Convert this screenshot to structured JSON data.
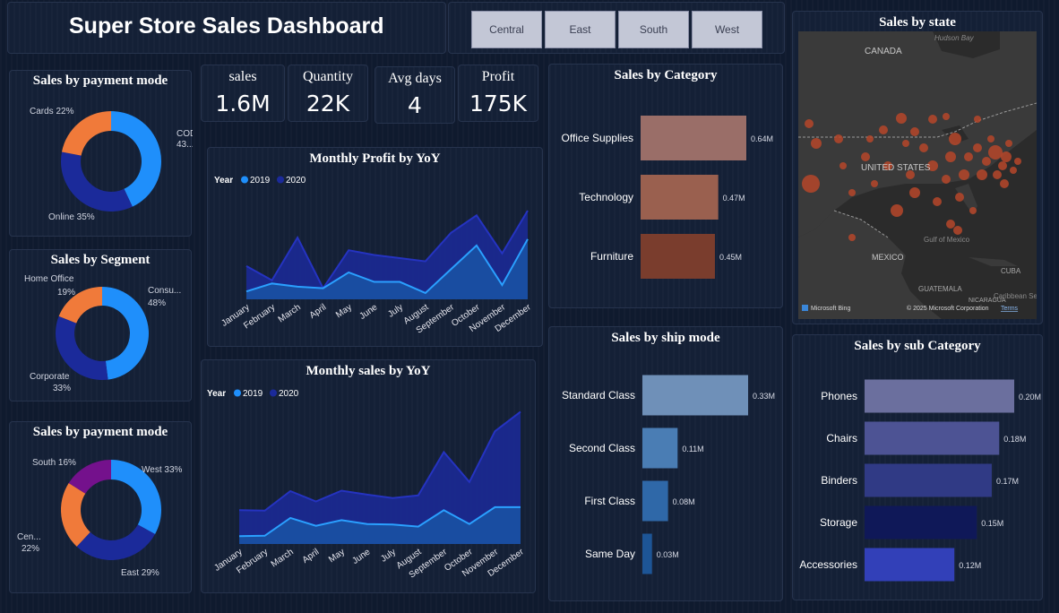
{
  "title": "Super Store Sales Dashboard",
  "slicer": [
    "Central",
    "East",
    "South",
    "West"
  ],
  "kpis": [
    {
      "label": "sales",
      "value": "1.6M"
    },
    {
      "label": "Quantity",
      "value": "22K"
    },
    {
      "label": "Avg days",
      "value": "4"
    },
    {
      "label": "Profit",
      "value": "175K"
    }
  ],
  "colors": {
    "background": "#0f1a2e",
    "panel": "#142036",
    "series2019": "#1f8ffb",
    "series2020": "#1b2a9a",
    "donut_blue": "#1f8ffb",
    "donut_orange": "#f07a3a",
    "donut_navy": "#1b2a9a",
    "donut_purple": "#74118c"
  },
  "map": {
    "title": "Sales by state",
    "labels": [
      "Hudson Bay",
      "CANADA",
      "UNITED STATES",
      "Gulf of Mexico",
      "MEXICO",
      "CUBA",
      "GUATEMALA",
      "Caribbean Se",
      "NICARAGUA"
    ],
    "attribution": "Microsoft Bing",
    "copyright": "© 2025 Microsoft Corporation",
    "terms": "Terms"
  },
  "chart_data": [
    {
      "id": "payment-mode-donut",
      "type": "pie",
      "title": "Sales by payment mode",
      "slices": [
        {
          "label": "COD",
          "value": 43,
          "display": "COD 43...",
          "color": "#1f8ffb"
        },
        {
          "label": "Online",
          "value": 35,
          "display": "Online 35%",
          "color": "#1b2a9a"
        },
        {
          "label": "Cards",
          "value": 22,
          "display": "Cards 22%",
          "color": "#f07a3a"
        }
      ]
    },
    {
      "id": "segment-donut",
      "type": "pie",
      "title": "Sales by Segment",
      "slices": [
        {
          "label": "Consumer",
          "value": 48,
          "display": "Consu... 48%",
          "color": "#1f8ffb"
        },
        {
          "label": "Corporate",
          "value": 33,
          "display": "Corporate 33%",
          "color": "#1b2a9a"
        },
        {
          "label": "Home Office",
          "value": 19,
          "display": "Home Office 19%",
          "color": "#f07a3a"
        }
      ]
    },
    {
      "id": "region-donut",
      "type": "pie",
      "title": "Sales by payment mode",
      "slices": [
        {
          "label": "West",
          "value": 33,
          "display": "West 33%",
          "color": "#1f8ffb"
        },
        {
          "label": "East",
          "value": 29,
          "display": "East 29%",
          "color": "#1b2a9a"
        },
        {
          "label": "Central",
          "value": 22,
          "display": "Cen... 22%",
          "color": "#f07a3a"
        },
        {
          "label": "South",
          "value": 16,
          "display": "South 16%",
          "color": "#74118c"
        }
      ]
    },
    {
      "id": "monthly-profit",
      "type": "area",
      "title": "Monthly Profit by YoY",
      "legend_title": "Year",
      "categories": [
        "January",
        "February",
        "March",
        "April",
        "May",
        "June",
        "July",
        "August",
        "September",
        "October",
        "November",
        "December"
      ],
      "series": [
        {
          "name": "2019",
          "values": [
            2.5,
            5.0,
            4.0,
            3.5,
            8.5,
            5.5,
            5.5,
            2.0,
            9.5,
            17.0,
            4.5,
            19.0
          ]
        },
        {
          "name": "2020",
          "values": [
            10.5,
            6.0,
            19.5,
            3.5,
            15.5,
            14.0,
            13.0,
            12.0,
            21.0,
            26.5,
            14.5,
            28.0
          ]
        }
      ],
      "ylim": [
        0,
        28
      ]
    },
    {
      "id": "monthly-sales",
      "type": "area",
      "title": "Monthly sales by YoY",
      "legend_title": "Year",
      "categories": [
        "January",
        "February",
        "March",
        "April",
        "May",
        "June",
        "July",
        "August",
        "September",
        "October",
        "November",
        "December"
      ],
      "series": [
        {
          "name": "2019",
          "values": [
            18,
            19,
            60,
            42,
            55,
            46,
            45,
            40,
            78,
            46,
            85,
            85
          ]
        },
        {
          "name": "2020",
          "values": [
            78,
            77,
            122,
            98,
            123,
            114,
            106,
            112,
            212,
            143,
            260,
            305
          ]
        }
      ],
      "ylim": [
        0,
        310
      ]
    },
    {
      "id": "category-bars",
      "type": "bar",
      "title": "Sales by Category",
      "categories": [
        "Office Supplies",
        "Technology",
        "Furniture"
      ],
      "values": [
        0.64,
        0.47,
        0.45
      ],
      "labels": [
        "0.64M",
        "0.47M",
        "0.45M"
      ],
      "colors": [
        "#9a6e68",
        "#9a604f",
        "#7a3d2d"
      ]
    },
    {
      "id": "shipmode-bars",
      "type": "bar",
      "title": "Sales by ship mode",
      "categories": [
        "Standard Class",
        "Second Class",
        "First Class",
        "Same Day"
      ],
      "values": [
        0.33,
        0.11,
        0.08,
        0.03
      ],
      "labels": [
        "0.33M",
        "0.11M",
        "0.08M",
        "0.03M"
      ],
      "colors": [
        "#6f90b8",
        "#4a7db4",
        "#2f68a8",
        "#1d5596"
      ]
    },
    {
      "id": "subcategory-bars",
      "type": "bar",
      "title": "Sales by sub Category",
      "categories": [
        "Phones",
        "Chairs",
        "Binders",
        "Storage",
        "Accessories"
      ],
      "values": [
        0.2,
        0.18,
        0.17,
        0.15,
        0.12
      ],
      "labels": [
        "0.20M",
        "0.18M",
        "0.17M",
        "0.15M",
        "0.12M"
      ],
      "colors": [
        "#6b6f9e",
        "#4d5394",
        "#303a85",
        "#0f1858",
        "#3240b8"
      ]
    }
  ]
}
